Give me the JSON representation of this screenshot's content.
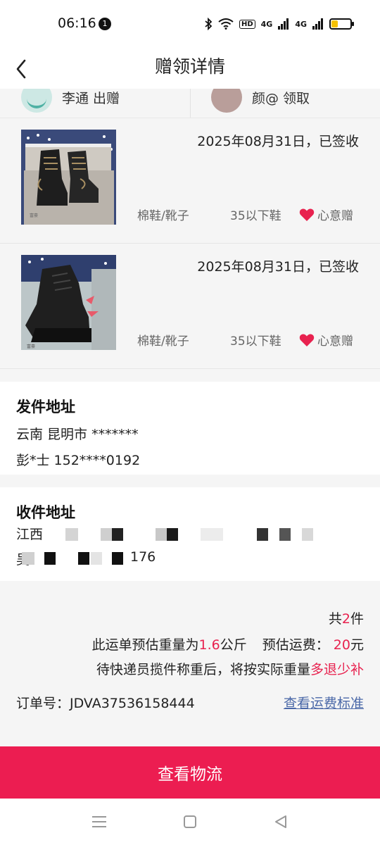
{
  "status_bar": {
    "time": "06:16",
    "notification_count": "1",
    "network_a": "4G",
    "network_b": "4G",
    "hd": "HD"
  },
  "header": {
    "title": "赠领详情"
  },
  "participants": {
    "giver_name": "李通 出赠",
    "receiver_name": "颜@ 领取"
  },
  "items": [
    {
      "date_status": "2025年08月31日，已签收",
      "category": "棉鞋/靴子",
      "size": "35以下鞋",
      "tag": "心意赠"
    },
    {
      "date_status": "2025年08月31日，已签收",
      "category": "棉鞋/靴子",
      "size": "35以下鞋",
      "tag": "心意赠"
    }
  ],
  "sender_address": {
    "title": "发件地址",
    "region": "云南 昆明市 *******",
    "contact": "彭*士 152****0192"
  },
  "receiver_address": {
    "title": "收件地址",
    "line1": "江西",
    "line2_prefix": "吴",
    "line2_suffix": "176"
  },
  "summary": {
    "count_prefix": "共",
    "count": "2",
    "count_suffix": "件",
    "weight_prefix": "此运单预估重量为",
    "weight": "1.6",
    "weight_unit": "公斤",
    "fee_prefix": "预估运费：",
    "fee": "20",
    "fee_unit": "元",
    "note_prefix": "待快递员揽件称重后，将按实际重量",
    "note_highlight": "多退少补",
    "order_label": "订单号：",
    "order_number": "JDVA37536158444",
    "fee_standard_link": "查看运费标准"
  },
  "actions": {
    "view_logistics": "查看物流"
  },
  "colors": {
    "accent": "#ec1d51",
    "link": "#4a68a8",
    "heart": "#e8224f"
  },
  "icons": [
    "back-icon",
    "heart-icon",
    "menu-icon",
    "home-icon",
    "back-nav-icon",
    "bluetooth-icon",
    "wifi-icon",
    "battery-icon"
  ]
}
